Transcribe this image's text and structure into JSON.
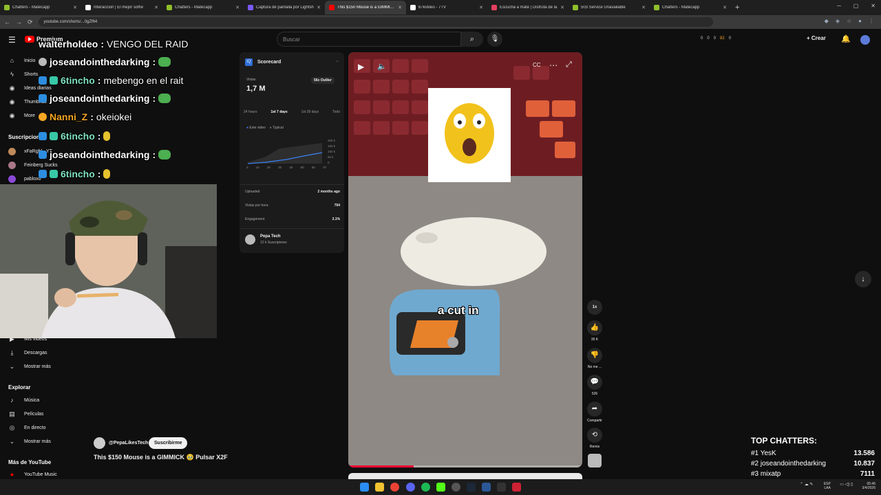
{
  "browser": {
    "tabs": [
      {
        "title": "Chatters - Matecapp",
        "color": "#8fbf2a"
      },
      {
        "title": "Interacción | El mejor softw",
        "color": "#ffffff"
      },
      {
        "title": "Chatters - Matecapp",
        "color": "#8fbf2a"
      },
      {
        "title": "Captura de pantalla por Lightsh",
        "color": "#7a5af8"
      },
      {
        "title": "This $150 Mouse is a GIMMICK",
        "color": "#ff0000",
        "active": true
      },
      {
        "title": "67kxkleo - 7TV",
        "color": "#ffffff"
      },
      {
        "title": "Escucha a mate | Disfruta de la",
        "color": "#e4405f"
      },
      {
        "title": "503 Service Unavailable",
        "color": "#8fbf2a"
      },
      {
        "title": "Chatters - Matecapp",
        "color": "#8fbf2a"
      }
    ],
    "url": "youtube.com/shorts/...0gZf64"
  },
  "header": {
    "logo_label": "Premium",
    "search_placeholder": "Buscar",
    "stats": [
      "0",
      "0",
      "0",
      "82",
      "0"
    ],
    "create_label": "Crear"
  },
  "sidebar": {
    "top_items": [
      "Inicio",
      "Shorts",
      "Ideas diarias",
      "Thumbnail",
      "More"
    ],
    "subs_heading": "Suscripciones",
    "subscriptions": [
      {
        "name": "xFaRgbl...YT",
        "color": "#c08a5a"
      },
      {
        "name": "Feinberg Sucks",
        "color": "#aa7788"
      },
      {
        "name": "pabloxo",
        "color": "#8a4ad6"
      }
    ],
    "you_items": [
      "Mis videos",
      "Descargas",
      "Mostrar más"
    ],
    "explore_heading": "Explorar",
    "explore_items": [
      "Música",
      "Películas",
      "En directo",
      "Mostrar más"
    ],
    "more_heading": "Más de YouTube",
    "more_items": [
      "YouTube Music"
    ]
  },
  "chat": [
    {
      "user": "walterholdeo",
      "message": "VENGO DEL RAID",
      "color": "#ffffff"
    },
    {
      "user": "joseandointhedarking",
      "message": "",
      "color": "#ffffff"
    },
    {
      "user": "6tincho",
      "message": "mebengo en el rait",
      "color": "#ffffff"
    },
    {
      "user": "joseandointhedarking",
      "message": "",
      "color": "#ffffff"
    },
    {
      "user": "Nanni_Z",
      "message": "okeiokei",
      "color": "#f5a623"
    },
    {
      "user": "6tincho",
      "message": "",
      "color": "#ffffff"
    },
    {
      "user": "joseandointhedarking",
      "message": "",
      "color": "#ffffff"
    },
    {
      "user": "6tincho",
      "message": "",
      "color": "#ffffff"
    }
  ],
  "scorecard": {
    "title": "Scorecard",
    "views_label": "Vistas",
    "views_value": "1,7 M",
    "outlier": "56x Outlier",
    "ranges": [
      "24 hours",
      "1st 7 days",
      "1st 28 days",
      "Todo"
    ],
    "legend": [
      "Este video",
      "Typical"
    ],
    "y_ticks": [
      "200 k",
      "150 k",
      "100 k",
      "50 k",
      "0"
    ],
    "x_ticks": [
      "0",
      "10",
      "20",
      "30",
      "40",
      "50",
      "60",
      "70"
    ],
    "rows": [
      {
        "label": "Uploaded",
        "value": "2 months ago"
      },
      {
        "label": "Vistas por hora",
        "value": "794"
      },
      {
        "label": "Engagement",
        "value": "2.1%"
      }
    ],
    "channel": {
      "name": "Pepa Tech",
      "subs": "12 k Suscriptores"
    }
  },
  "video": {
    "caption": "a cut in",
    "channel_handle": "@PepaLikesTech",
    "subscribe_label": "Suscribirme",
    "title": "This $150 Mouse is a GIMMICK 🥹 Pulsar X2F",
    "progress": 0.28
  },
  "actions": {
    "speed": "1x",
    "likes": "35 K",
    "dislike_label": "No me ...",
    "comments": "526",
    "share_label": "Compartir",
    "remix_label": "Remix"
  },
  "top_chatters": {
    "title": "TOP CHATTERS:",
    "rows": [
      {
        "rank": "#1 YesK",
        "value": "13.586"
      },
      {
        "rank": "#2 joseandointhedarking",
        "value": "10.837"
      },
      {
        "rank": "#3 mixatp",
        "value": "7111"
      }
    ]
  },
  "taskbar": {
    "lang": "ESP",
    "region": "LAA",
    "time": "05:46",
    "date": "3/4/2026"
  }
}
